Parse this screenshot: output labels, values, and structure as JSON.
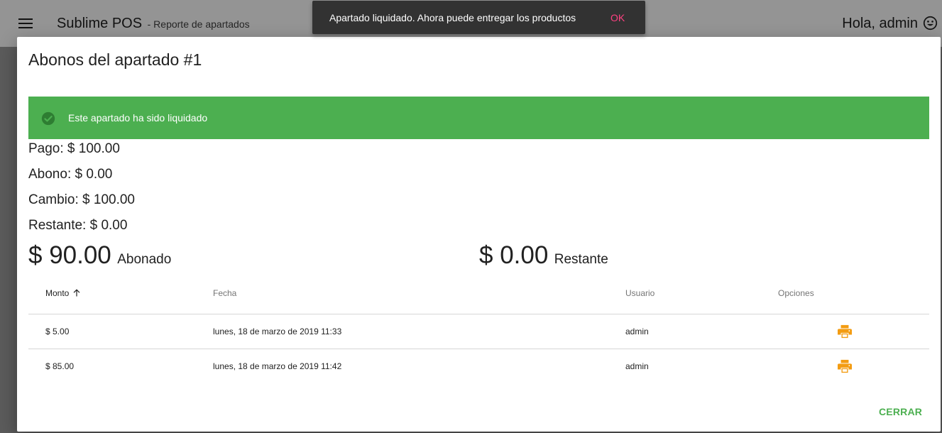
{
  "header": {
    "app_name": "Sublime POS",
    "subtitle": "- Reporte de apartados",
    "greeting": "Hola, admin"
  },
  "snackbar": {
    "message": "Apartado liquidado. Ahora puede entregar los productos",
    "action": "OK"
  },
  "dialog": {
    "title": "Abonos del apartado #1",
    "alert": "Este apartado ha sido liquidado",
    "details": [
      "Pago: $ 100.00",
      "Abono: $ 0.00",
      "Cambio: $ 100.00",
      "Restante: $ 0.00"
    ],
    "abonado": {
      "amount": "$ 90.00",
      "label": "Abonado"
    },
    "restante": {
      "amount": "$ 0.00",
      "label": "Restante"
    },
    "table": {
      "columns": [
        "Monto",
        "Fecha",
        "Usuario",
        "Opciones"
      ],
      "sorted_column": "Monto",
      "rows": [
        {
          "monto": "$ 5.00",
          "fecha": "lunes, 18 de marzo de 2019 11:33",
          "usuario": "admin"
        },
        {
          "monto": "$ 85.00",
          "fecha": "lunes, 18 de marzo de 2019 11:42",
          "usuario": "admin"
        }
      ]
    },
    "close_label": "CERRAR"
  },
  "icons": [
    "menu-icon",
    "smile-icon",
    "check-circle-icon",
    "arrow-up-icon",
    "print-icon"
  ],
  "colors": {
    "success": "#4caf50",
    "print_icon": "#f39c12",
    "snackbar_bg": "#323232",
    "snackbar_action": "#ff4081"
  }
}
